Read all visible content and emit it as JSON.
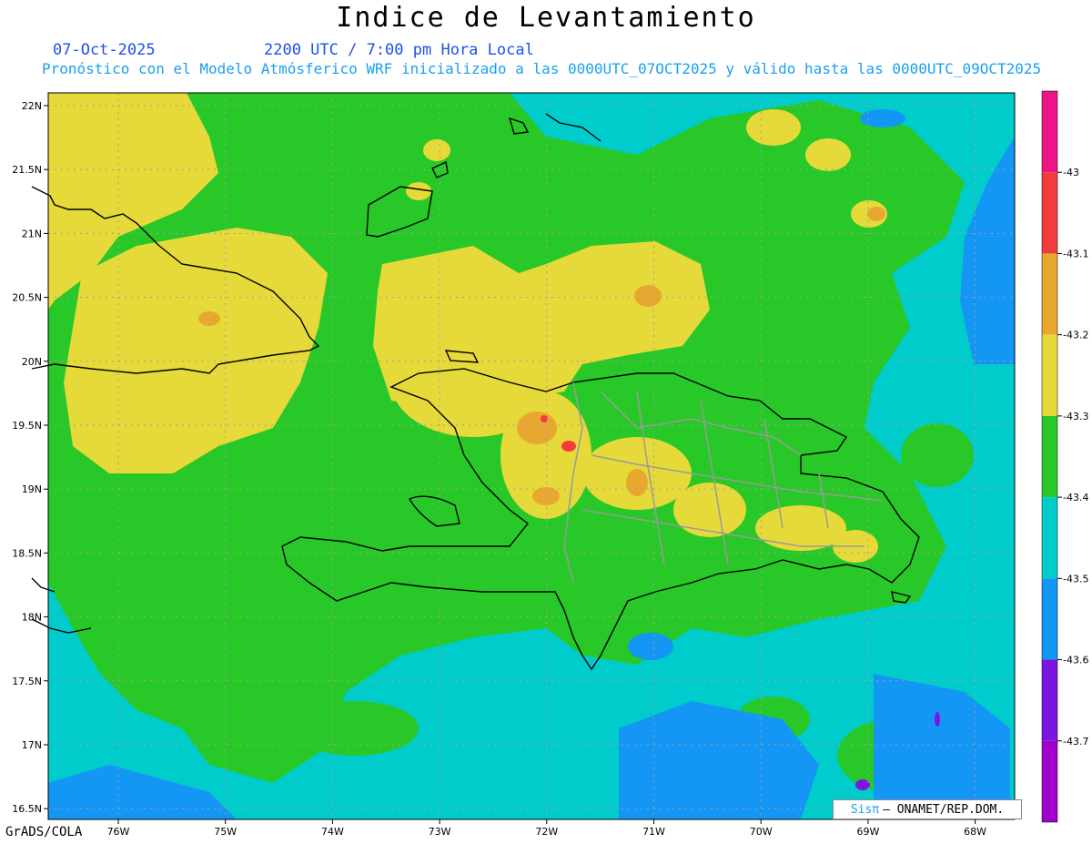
{
  "title": "Indice de Levantamiento",
  "date": "07-Oct-2025",
  "time": "2200 UTC / 7:00 pm Hora Local",
  "forecast_line": "Pronóstico con el Modelo Atmósferico WRF inicializado a las 0000UTC_07OCT2025 y válido hasta las  0000UTC_09OCT2025",
  "footer": "GrADS/COLA",
  "credit": {
    "logo": "Sisπ",
    "text": "– ONAMET/REP.DOM."
  },
  "map": {
    "lat_labels": [
      "22N",
      "21.5N",
      "21N",
      "20.5N",
      "20N",
      "19.5N",
      "19N",
      "18.5N",
      "18N",
      "17.5N",
      "17N",
      "16.5N"
    ],
    "lon_labels": [
      "76W",
      "75W",
      "74W",
      "73W",
      "72W",
      "71W",
      "70W",
      "69W",
      "68W"
    ]
  },
  "colorbar": {
    "labels": [
      "-43",
      "-43.1",
      "-43.2",
      "-43.3",
      "-43.4",
      "-43.5",
      "-43.6",
      "-43.7"
    ],
    "colors": [
      "#ee1488",
      "#f23c3c",
      "#e8a830",
      "#e6d93a",
      "#28c828",
      "#00cccc",
      "#1496f5",
      "#7a16e0",
      "#a000cc"
    ]
  }
}
